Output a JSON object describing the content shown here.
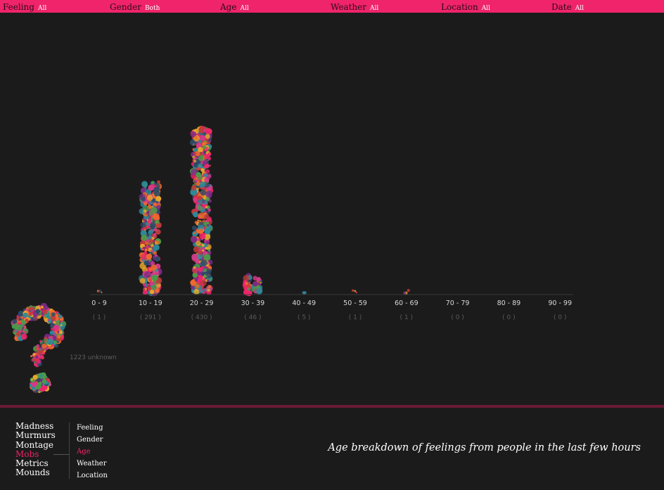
{
  "filters": [
    {
      "label": "Feeling",
      "value": "All"
    },
    {
      "label": "Gender",
      "value": "Both"
    },
    {
      "label": "Age",
      "value": "All"
    },
    {
      "label": "Weather",
      "value": "All"
    },
    {
      "label": "Location",
      "value": "All"
    },
    {
      "label": "Date",
      "value": "All"
    }
  ],
  "chart_data": {
    "type": "bar",
    "categories": [
      "0 - 9",
      "10 - 19",
      "20 - 29",
      "30 - 39",
      "40 - 49",
      "50 - 59",
      "60 - 69",
      "70 - 79",
      "80 - 89",
      "90 - 99"
    ],
    "values": [
      1,
      291,
      430,
      46,
      5,
      1,
      1,
      0,
      0,
      0
    ],
    "count_labels": [
      "( 1 )",
      "( 291 )",
      "( 430 )",
      "( 46 )",
      "( 5 )",
      "( 1 )",
      "( 1 )",
      "( 0 )",
      "( 0 )",
      "( 0 )"
    ],
    "unknown": {
      "count": 1223,
      "label": "1223 unknown"
    },
    "colors": [
      "#f0246a",
      "#e8a82a",
      "#2a4b66",
      "#2b8a9a",
      "#7b2b86",
      "#c23a3a",
      "#f26a2b",
      "#4b9a4a",
      "#d43a8a"
    ],
    "axis_color": "#3a3a3a"
  },
  "nav": {
    "items": [
      {
        "label": "Madness",
        "active": false
      },
      {
        "label": "Murmurs",
        "active": false
      },
      {
        "label": "Montage",
        "active": false
      },
      {
        "label": "Mobs",
        "active": true
      },
      {
        "label": "Metrics",
        "active": false
      },
      {
        "label": "Mounds",
        "active": false
      }
    ]
  },
  "subnav": {
    "items": [
      {
        "label": "Feeling",
        "active": false
      },
      {
        "label": "Gender",
        "active": false
      },
      {
        "label": "Age",
        "active": true
      },
      {
        "label": "Weather",
        "active": false
      },
      {
        "label": "Location",
        "active": false
      }
    ]
  },
  "caption": "Age breakdown of feelings from people in the last few hours"
}
